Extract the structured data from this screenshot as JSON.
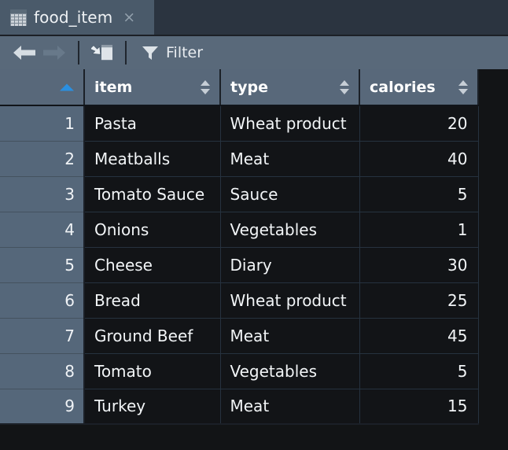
{
  "window": {
    "tab": {
      "icon": "table-grid-icon",
      "label": "food_item",
      "close_label": "×"
    }
  },
  "toolbar": {
    "back": {
      "icon": "arrow-left-icon",
      "label": "Back"
    },
    "forward": {
      "icon": "arrow-right-icon",
      "label": "Forward"
    },
    "import": {
      "icon": "import-into-table-icon",
      "label": "Import"
    },
    "filter": {
      "icon": "funnel-icon",
      "label": "Filter"
    }
  },
  "grid": {
    "sort_column": "row-number",
    "sort_direction": "ascending",
    "accent": "#2a8fe0",
    "columns": [
      {
        "key": "rownum",
        "label": "",
        "sort": "asc-active",
        "align": "right"
      },
      {
        "key": "item",
        "label": "item",
        "sort": "none",
        "align": "left"
      },
      {
        "key": "type",
        "label": "type",
        "sort": "none",
        "align": "left"
      },
      {
        "key": "calories",
        "label": "calories",
        "sort": "none",
        "align": "right"
      }
    ],
    "rows": [
      {
        "rownum": "1",
        "item": "Pasta",
        "type": "Wheat product",
        "calories": "20"
      },
      {
        "rownum": "2",
        "item": "Meatballs",
        "type": "Meat",
        "calories": "40"
      },
      {
        "rownum": "3",
        "item": "Tomato Sauce",
        "type": "Sauce",
        "calories": "5"
      },
      {
        "rownum": "4",
        "item": "Onions",
        "type": "Vegetables",
        "calories": "1"
      },
      {
        "rownum": "5",
        "item": "Cheese",
        "type": "Diary",
        "calories": "30"
      },
      {
        "rownum": "6",
        "item": "Bread",
        "type": "Wheat product",
        "calories": "25"
      },
      {
        "rownum": "7",
        "item": "Ground Beef",
        "type": "Meat",
        "calories": "45"
      },
      {
        "rownum": "8",
        "item": "Tomato",
        "type": "Vegetables",
        "calories": "5"
      },
      {
        "rownum": "9",
        "item": "Turkey",
        "type": "Meat",
        "calories": "15"
      }
    ]
  }
}
